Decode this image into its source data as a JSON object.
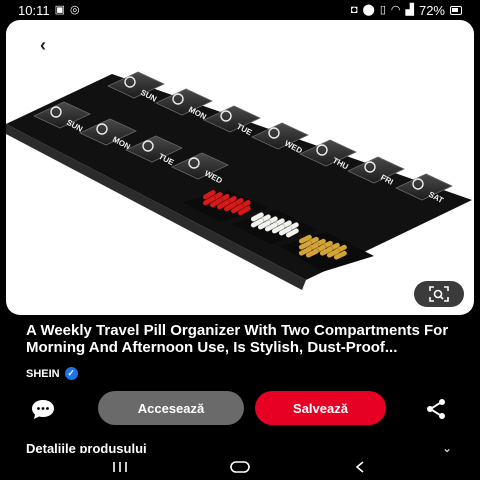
{
  "status_bar": {
    "time": "10:11",
    "battery_percent": "72%",
    "icons_left": [
      "image-icon",
      "whatsapp-icon"
    ],
    "icons_right": [
      "camera-icon",
      "location-icon",
      "vibrate-icon",
      "wifi-icon",
      "signal-icon",
      "battery-icon"
    ]
  },
  "product": {
    "title": "A Weekly Travel Pill Organizer With Two Compartments For Morning And Afternoon Use, Is Stylish, Dust-Proof...",
    "source": "SHEIN",
    "verified": true,
    "pill_colors": [
      "#d51a1a",
      "#f2f2ee",
      "#d4a437"
    ]
  },
  "organizer": {
    "top_row": [
      "SUN",
      "MON",
      "TUE",
      "WED",
      "THU",
      "FRI",
      "SAT"
    ],
    "bottom_row": [
      "SUN",
      "MON",
      "TUE",
      "WED"
    ]
  },
  "actions": {
    "visit_label": "Accesează",
    "save_label": "Salvează",
    "save_color": "#e60023"
  },
  "details": {
    "label": "Detaliile produsului"
  }
}
